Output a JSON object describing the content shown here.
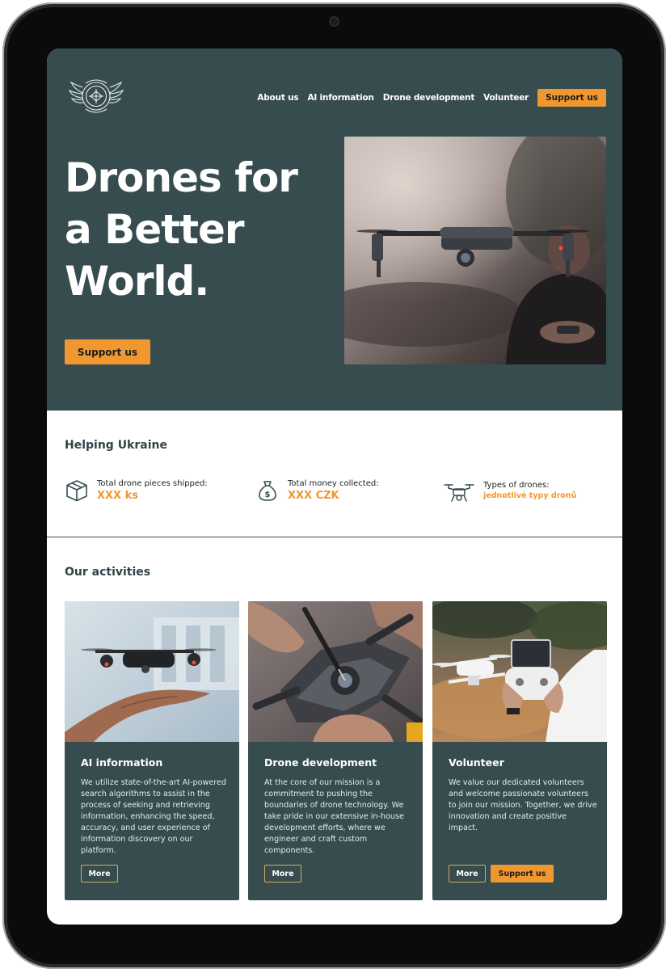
{
  "nav": {
    "links": [
      "About us",
      "AI information",
      "Drone development",
      "Volunteer"
    ],
    "cta": "Support us",
    "logo_top_text": "ČESKÁ REPUBLIKA",
    "logo_bottom_text": "AEROKOZVĚDKA"
  },
  "hero": {
    "title": "Drones for a Better World.",
    "button": "Support us"
  },
  "helping": {
    "title": "Helping Ukraine",
    "stats": [
      {
        "icon": "box-icon",
        "label": "Total drone pieces shipped:",
        "value": "XXX ks"
      },
      {
        "icon": "money-bag-icon",
        "label": "Total money collected:",
        "value": "XXX CZK"
      },
      {
        "icon": "drone-icon",
        "label": "Types of drones:",
        "value": "jednotlivé typy dronů"
      }
    ]
  },
  "activities": {
    "title": "Our activities",
    "cards": [
      {
        "title": "AI information",
        "text": "We utilize state-of-the-art AI-powered search algorithms to assist in the process of seeking and retrieving information, enhancing the speed, accuracy, and user experience of information discovery on our platform.",
        "more": "More"
      },
      {
        "title": "Drone development",
        "text": "At the core of our mission is a commitment to pushing the boundaries of drone technology. We take pride in our extensive in-house development efforts, where we engineer and craft custom components.",
        "more": "More"
      },
      {
        "title": "Volunteer",
        "text": "We value our dedicated volunteers and welcome passionate volunteers to join our mission. Together, we drive innovation and create positive impact.",
        "more": "More",
        "support": "Support us"
      }
    ]
  },
  "colors": {
    "primary": "#364c4e",
    "accent": "#f0982f",
    "background": "#ffffff"
  }
}
